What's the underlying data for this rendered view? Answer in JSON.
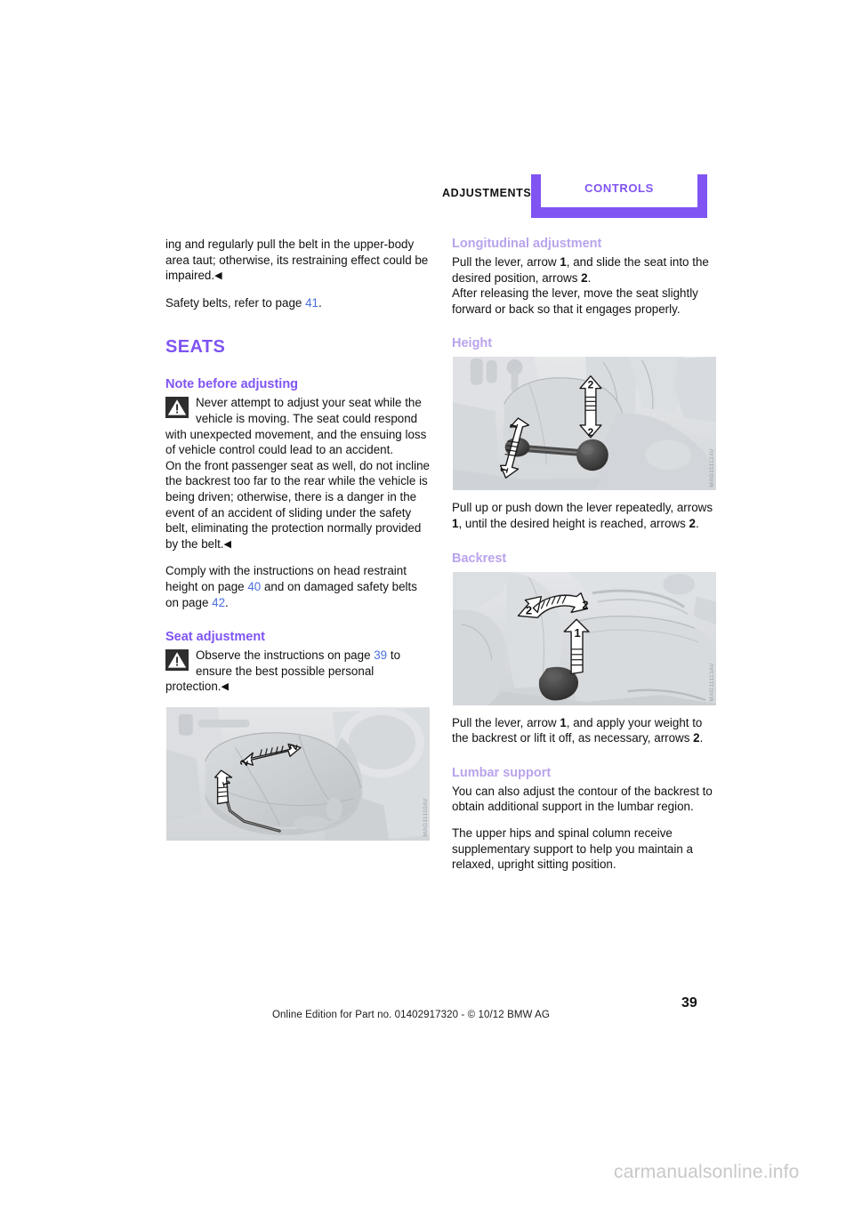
{
  "header": {
    "left_label": "ADJUSTMENTS",
    "right_label": "CONTROLS",
    "accent_color": "#7f54f2"
  },
  "left_column": {
    "continued_paragraph": "ing and regularly pull the belt in the upper-body area taut; otherwise, its restraining effect could be impaired.",
    "continued_endmark": "◀",
    "safety_belts_ref_pre": "Safety belts, refer to page ",
    "safety_belts_ref_page": "41",
    "safety_belts_ref_post": ".",
    "section_title": "SEATS",
    "note_heading": "Note before adjusting",
    "note_warning_text": "Never attempt to adjust your seat while the vehicle is moving. The seat could respond with unexpected movement, and the ensuing loss of vehicle control could lead to an accident.",
    "note_warning_text2": "On the front passenger seat as well, do not incline the backrest too far to the rear while the vehicle is being driven; otherwise, there is a danger in the event of an accident of sliding under the safety belt, eliminating the protection normally provided by the belt.",
    "note_warning_endmark": "◀",
    "comply_pre": "Comply with the instructions on head restraint height on page ",
    "comply_page_a": "40",
    "comply_mid": " and on damaged safety belts on page ",
    "comply_page_b": "42",
    "comply_post": ".",
    "seat_adjustment_heading": "Seat adjustment",
    "seat_adjustment_warning_pre": "Observe the instructions on page ",
    "seat_adjustment_warning_page": "39",
    "seat_adjustment_warning_post": " to ensure the best possible personal protection.",
    "seat_adjustment_endmark": "◀",
    "figure_code": "MAG11110AV"
  },
  "right_column": {
    "longitudinal_heading": "Longitudinal adjustment",
    "longitudinal_text1_a": "Pull the lever, arrow ",
    "longitudinal_text1_b": "1",
    "longitudinal_text1_c": ", and slide the seat into the desired position, arrows ",
    "longitudinal_text1_d": "2",
    "longitudinal_text1_e": ".",
    "longitudinal_text2": "After releasing the lever, move the seat slightly forward or back so that it engages properly.",
    "height_heading": "Height",
    "height_figure_code": "MAG11112AV",
    "height_text_a": "Pull up or push down the lever repeatedly, arrows ",
    "height_text_b": "1",
    "height_text_c": ", until the desired height is reached, arrows ",
    "height_text_d": "2",
    "height_text_e": ".",
    "backrest_heading": "Backrest",
    "backrest_figure_code": "MAG11113AV",
    "backrest_text_a": "Pull the lever, arrow ",
    "backrest_text_b": "1",
    "backrest_text_c": ", and apply your weight to the backrest or lift it off, as necessary, arrows ",
    "backrest_text_d": "2",
    "backrest_text_e": ".",
    "lumbar_heading": "Lumbar support",
    "lumbar_text1": "You can also adjust the contour of the backrest to obtain additional support in the lumbar region.",
    "lumbar_text2": "The upper hips and spinal column receive supplementary support to help you maintain a relaxed, upright sitting position."
  },
  "footer": {
    "edition_line": "Online Edition for Part no. 01402917320 - © 10/12 BMW AG",
    "page_number": "39",
    "watermark": "carmanualsonline.info"
  }
}
